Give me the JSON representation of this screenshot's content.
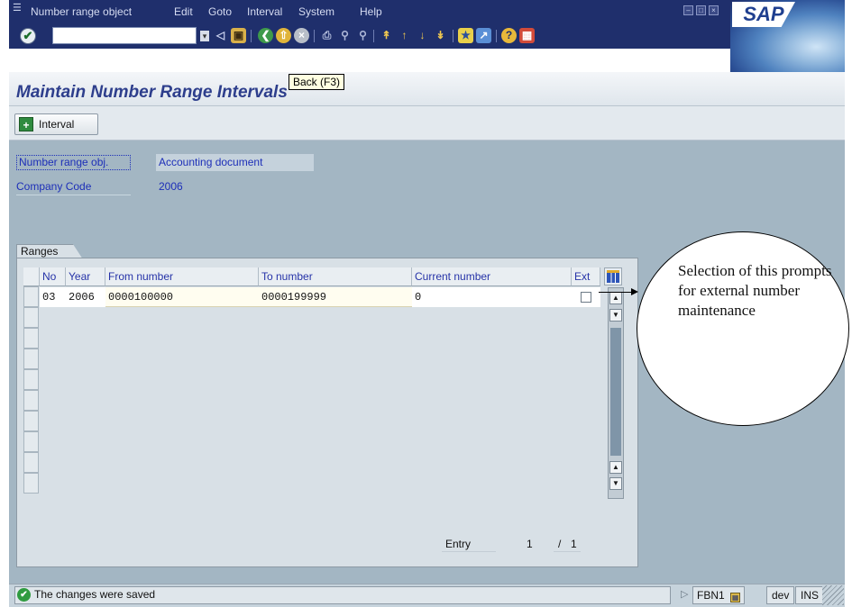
{
  "menubar": {
    "items": [
      "Number range object",
      "Edit",
      "Goto",
      "Interval",
      "System",
      "Help"
    ],
    "logo": "SAP"
  },
  "toolbar": {
    "command_field_value": "",
    "tooltip": "Back  (F3)"
  },
  "title": "Maintain Number Range Intervals",
  "app_toolbar": {
    "interval_button": "Interval"
  },
  "header_fields": {
    "number_range_obj_label": "Number range obj.",
    "number_range_obj_value": "Accounting document",
    "company_code_label": "Company Code",
    "company_code_value": "2006"
  },
  "ranges": {
    "tab_label": "Ranges",
    "columns": [
      "No",
      "Year",
      "From number",
      "To number",
      "Current number",
      "Ext"
    ],
    "rows": [
      {
        "no": "03",
        "year": "2006",
        "from": "0000100000",
        "to": "0000199999",
        "current": "0",
        "ext": false
      }
    ],
    "entry_label": "Entry",
    "entry_current": "1",
    "entry_sep": "/",
    "entry_total": "1"
  },
  "callout": {
    "text": "Selection of this prompts for external number maintenance"
  },
  "statusbar": {
    "message": "The changes were saved",
    "transaction": "FBN1",
    "system": "dev",
    "mode": "INS"
  },
  "colors": {
    "menubar": "#1f2f6c",
    "main_bg": "#a3b6c3",
    "title_text": "#2d3e8c",
    "label_blue": "#1d2fb8"
  }
}
